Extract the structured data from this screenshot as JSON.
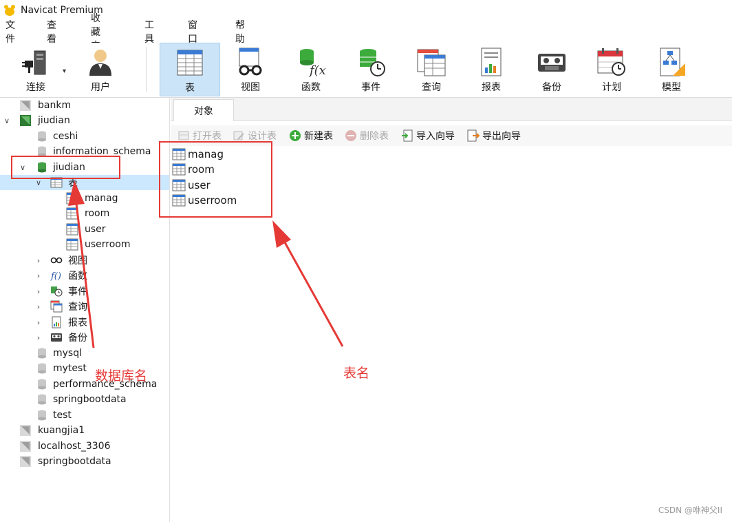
{
  "window": {
    "title": "Navicat Premium"
  },
  "menu": [
    "文件",
    "查看",
    "收藏夹",
    "工具",
    "窗口",
    "帮助"
  ],
  "toolbar": {
    "buttons": [
      {
        "label": "连接",
        "icon": "plug-icon"
      },
      {
        "label": "用户",
        "icon": "user-icon"
      },
      {
        "label": "表",
        "icon": "table-icon",
        "active": true
      },
      {
        "label": "视图",
        "icon": "glasses-icon"
      },
      {
        "label": "函数",
        "icon": "function-icon"
      },
      {
        "label": "事件",
        "icon": "event-clock-icon"
      },
      {
        "label": "查询",
        "icon": "query-icon"
      },
      {
        "label": "报表",
        "icon": "report-icon"
      },
      {
        "label": "备份",
        "icon": "backup-icon"
      },
      {
        "label": "计划",
        "icon": "calendar-icon"
      },
      {
        "label": "模型",
        "icon": "model-icon"
      }
    ]
  },
  "tree": {
    "connections": [
      {
        "label": "bankm"
      },
      {
        "label": "jiudian"
      },
      {
        "label": "kuangjia1"
      },
      {
        "label": "localhost_3306"
      },
      {
        "label": "springbootdata"
      }
    ],
    "databases": [
      "ceshi",
      "information_schema",
      "jiudian",
      "mysql",
      "mytest",
      "performance_schema",
      "springbootdata",
      "test"
    ],
    "tables_node": "表",
    "tables": [
      "manag",
      "room",
      "user",
      "userroom"
    ],
    "groups": [
      "视图",
      "函数",
      "事件",
      "查询",
      "报表",
      "备份"
    ]
  },
  "right": {
    "tab": "对象",
    "actions": [
      {
        "label": "打开表",
        "enabled": false
      },
      {
        "label": "设计表",
        "enabled": false
      },
      {
        "label": "新建表",
        "enabled": true
      },
      {
        "label": "删除表",
        "enabled": false
      },
      {
        "label": "导入向导",
        "enabled": true
      },
      {
        "label": "导出向导",
        "enabled": true
      }
    ],
    "objects": [
      "manag",
      "room",
      "user",
      "userroom"
    ]
  },
  "annotations": {
    "db_label": "数据库名",
    "table_label": "表名",
    "color": "#e53935"
  },
  "watermark": "CSDN @咻神父II"
}
